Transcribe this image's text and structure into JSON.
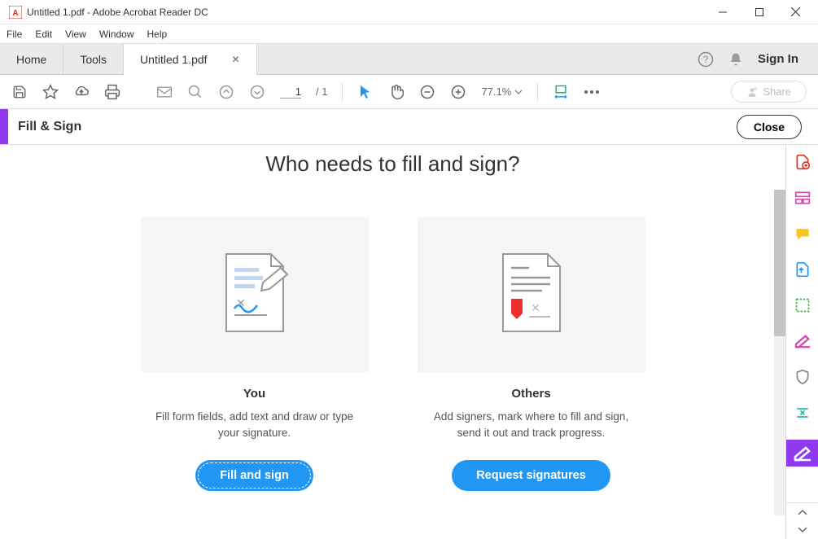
{
  "titlebar": {
    "title": "Untitled 1.pdf - Adobe Acrobat Reader DC"
  },
  "menubar": {
    "items": [
      "File",
      "Edit",
      "View",
      "Window",
      "Help"
    ]
  },
  "tabbar": {
    "home": "Home",
    "tools": "Tools",
    "doc_tab": "Untitled 1.pdf",
    "signin": "Sign In"
  },
  "toolbar": {
    "page_current": "1",
    "page_total": "/ 1",
    "zoom": "77.1%",
    "share": "Share"
  },
  "subheader": {
    "label": "Fill & Sign",
    "close": "Close"
  },
  "content": {
    "heading": "Who needs to fill and sign?",
    "card_you": {
      "title": "You",
      "desc": "Fill form fields, add text and draw or type your signature.",
      "button": "Fill and sign"
    },
    "card_others": {
      "title": "Others",
      "desc": "Add signers, mark where to fill and sign, send it out and track progress.",
      "button": "Request signatures"
    }
  }
}
